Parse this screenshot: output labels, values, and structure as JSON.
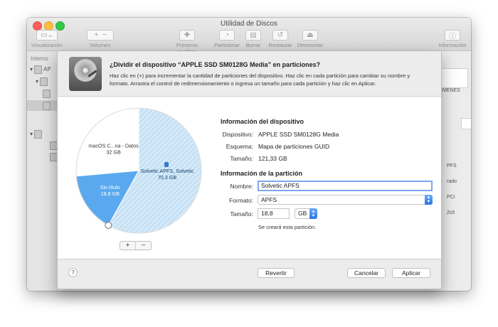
{
  "window": {
    "title": "Utilidad de Discos"
  },
  "toolbar": {
    "view_label": "Visualización",
    "volume_label": "Volumen",
    "firstaid_label": "Primeros auxilios",
    "partition_label": "Particionar",
    "erase_label": "Borrar",
    "restore_label": "Restaurar",
    "unmount_label": "Desmontar",
    "info_label": "Información"
  },
  "sidebar": {
    "header": "Interno",
    "item_prefix": "AP"
  },
  "background": {
    "label_imenes": "IMENES",
    "r1": "PFS",
    "r2": "rado",
    "r3": "PCI",
    "r4": "2s5"
  },
  "dialog": {
    "title": "¿Dividir el dispositivo “APPLE SSD SM0128G Media” en particiones?",
    "description": "Haz clic en (+) para incrementar la cantidad de particiones del dispositivo. Haz clic en cada partición para cambiar su nombre y formato. Arrastra el control de redimensionamiento o ingresa un tamaño para cada partición y haz clic en Aplicar.",
    "pie": {
      "slices": [
        {
          "name": "macOS C...na - Datos",
          "size": "32 GB",
          "gb": 32,
          "color": "#ffffff"
        },
        {
          "name": "Solvetic APFS, Solvetic",
          "size": "70,3 GB",
          "gb": 70.3,
          "color": "#cfe6f6"
        },
        {
          "name": "Sin título",
          "size": "18,8 GB",
          "gb": 18.8,
          "color": "#56a6ee"
        }
      ]
    },
    "plus": "+",
    "minus": "−",
    "device_section": "Información del dispositivo",
    "device_label": "Dispositivo:",
    "device_value": "APPLE SSD SM0128G Media",
    "scheme_label": "Esquema:",
    "scheme_value": "Mapa de particiones GUID",
    "size_label": "Tamaño:",
    "size_value": "121,33 GB",
    "partition_section": "Información de la partición",
    "name_label": "Nombre:",
    "name_value": "Solvetic APFS",
    "format_label": "Formato:",
    "format_value": "APFS",
    "psize_label": "Tamaño:",
    "psize_value": "18,8",
    "unit_value": "GB",
    "note": "Se creará esta partición.",
    "help": "?",
    "revert": "Revertir",
    "cancel": "Cancelar",
    "apply": "Aplicar"
  }
}
